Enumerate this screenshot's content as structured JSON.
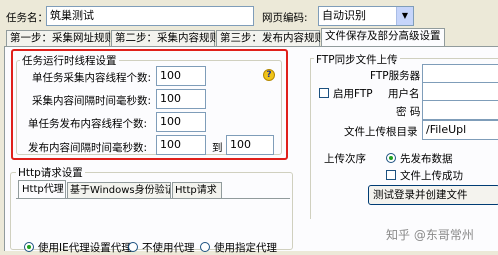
{
  "top": {
    "task_name_label": "任务名：",
    "task_name_value": "筑巢测试",
    "encoding_label": "网页编码:",
    "encoding_value": "自动识别"
  },
  "tabs": [
    {
      "label": "第一步：采集网址规则"
    },
    {
      "label": "第二步：采集内容规则"
    },
    {
      "label": "第三步：发布内容规则"
    },
    {
      "label": "文件保存及部分高级设置"
    }
  ],
  "thread_settings": {
    "title": "任务运行时线程设置",
    "rows": [
      {
        "label": "单任务采集内容线程个数:",
        "value": "100"
      },
      {
        "label": "采集内容间隔时间毫秒数:",
        "value": "100"
      },
      {
        "label": "单任务发布内容线程个数:",
        "value": "100"
      },
      {
        "label": "发布内容间隔时间毫秒数:",
        "value": "100",
        "to_label": "到",
        "to_value": "100"
      }
    ]
  },
  "http": {
    "title": "Http请求设置",
    "tabs": [
      {
        "label": "Http代理"
      },
      {
        "label": "基于Windows身份验证"
      },
      {
        "label": "Http请求"
      }
    ],
    "options": [
      "使用IE代理设置代理",
      "不使用代理",
      "使用指定代理"
    ]
  },
  "ftp": {
    "title": "FTP同步文件上传",
    "enable_label": "启用FTP",
    "server_label": "FTP服务器",
    "user_label": "用户名",
    "password_label": "密 码",
    "dir_label": "文件上传根目录",
    "dir_value": "/FileUpl",
    "order_label": "上传次序",
    "order_option": "先发布数据",
    "after_upload_label": "文件上传成功",
    "test_button": "测试登录并创建文件"
  },
  "watermark": "知乎 @东哥常州",
  "colors": {
    "highlight": "#e0201b",
    "help": "#f0c419"
  }
}
